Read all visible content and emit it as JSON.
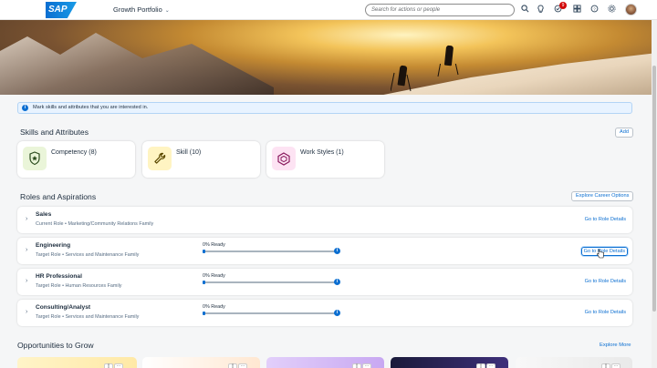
{
  "shell": {
    "logo_text": "SAP",
    "app_title": "Growth Portfolio",
    "search_placeholder": "Search for actions or people",
    "notification_count": "9"
  },
  "info_message": "Mark skills and attributes that you are interested in.",
  "skills": {
    "title": "Skills and Attributes",
    "add_label": "Add",
    "tiles": [
      {
        "label": "Competency (8)",
        "icon": "shield-star-icon",
        "color": "#eaf5d9"
      },
      {
        "label": "Skill (10)",
        "icon": "wrench-icon",
        "color": "#fff4c2"
      },
      {
        "label": "Work Styles (1)",
        "icon": "cube-icon",
        "color": "#fde3f3"
      }
    ]
  },
  "roles": {
    "title": "Roles and Aspirations",
    "explore_label": "Explore Career Options",
    "items": [
      {
        "name": "Sales",
        "sub": "Current Role • Marketing/Community Relations Family",
        "ready": "",
        "link": "Go to Role Details",
        "progress": 0
      },
      {
        "name": "Engineering",
        "sub": "Target Role • Services and Maintenance Family",
        "ready": "0% Ready",
        "link": "Go to Role Details",
        "progress": 0
      },
      {
        "name": "HR Professional",
        "sub": "Target Role • Human Resources Family",
        "ready": "0% Ready",
        "link": "Go to Role Details",
        "progress": 0
      },
      {
        "name": "Consulting/Analyst",
        "sub": "Target Role • Services and Maintenance Family",
        "ready": "0% Ready",
        "link": "Go to Role Details",
        "progress": 0
      }
    ]
  },
  "opportunities": {
    "title": "Opportunities to Grow",
    "explore_label": "Explore More"
  },
  "colors": {
    "accent": "#0a6ed1",
    "text": "#1d2d3e",
    "background": "#f5f6f7"
  }
}
